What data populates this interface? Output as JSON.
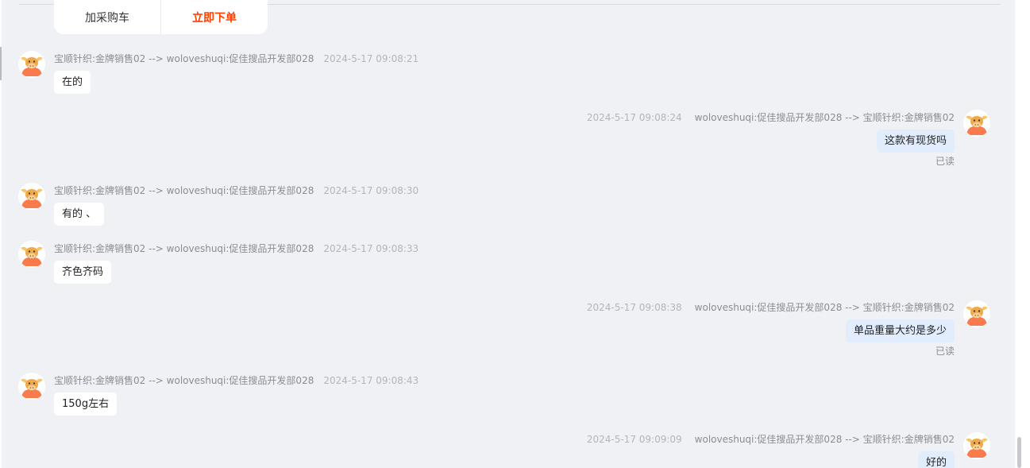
{
  "actions": {
    "add_cart": "加采购车",
    "order_now": "立即下单"
  },
  "colors": {
    "accent": "#ff4000",
    "my_bubble": "#e1ecfd",
    "panel_bg": "#f0f1f5"
  },
  "messages": [
    {
      "sender": "宝顺针织:金牌销售02 --> woloveshuqi:促佳搜品开发部028",
      "time": "2024-5-17 09:08:21",
      "text": "在的"
    },
    {
      "sender": "woloveshuqi:促佳搜品开发部028 --> 宝顺针织:金牌销售02",
      "time": "2024-5-17 09:08:24",
      "text": "这款有现货吗",
      "status": "已读"
    },
    {
      "sender": "宝顺针织:金牌销售02 --> woloveshuqi:促佳搜品开发部028",
      "time": "2024-5-17 09:08:30",
      "text": "有的 、"
    },
    {
      "sender": "宝顺针织:金牌销售02 --> woloveshuqi:促佳搜品开发部028",
      "time": "2024-5-17 09:08:33",
      "text": "齐色齐码"
    },
    {
      "sender": "woloveshuqi:促佳搜品开发部028 --> 宝顺针织:金牌销售02",
      "time": "2024-5-17 09:08:38",
      "text": "单品重量大约是多少",
      "status": "已读"
    },
    {
      "sender": "宝顺针织:金牌销售02 --> woloveshuqi:促佳搜品开发部028",
      "time": "2024-5-17 09:08:43",
      "text": "150g左右"
    },
    {
      "sender": "woloveshuqi:促佳搜品开发部028 --> 宝顺针织:金牌销售02",
      "time": "2024-5-17 09:09:09",
      "text": "好的"
    }
  ]
}
